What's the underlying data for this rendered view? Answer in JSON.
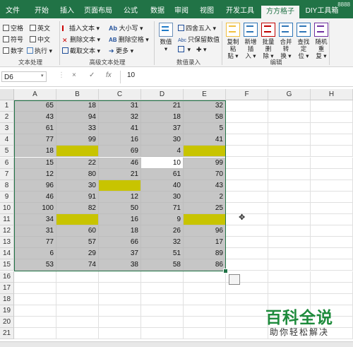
{
  "tabs": [
    "文件",
    "开始",
    "插入",
    "页面布局",
    "公式",
    "数据",
    "审阅",
    "视图",
    "开发工具",
    "方方格子",
    "DIY工具箱"
  ],
  "active_tab": "方方格子",
  "top_right_text": "8888",
  "ribbon": {
    "text_group": {
      "items": [
        "空格",
        "英文",
        "符号",
        "中文",
        "数字",
        "执行"
      ],
      "label": "文本处理"
    },
    "adv_group": {
      "items": [
        "插入文本",
        "大小写",
        "删除文本",
        "删除空格",
        "截取文本",
        "更多"
      ],
      "label": "高级文本处理"
    },
    "input_group": {
      "number_btn": "数值",
      "round": "四舍五入",
      "keep_value": "只保留数值",
      "label": "数值录入"
    },
    "edit_group": {
      "buttons": [
        {
          "l1": "复制粘",
          "l2": "贴"
        },
        {
          "l1": "新增插",
          "l2": "入"
        },
        {
          "l1": "批量删",
          "l2": "除"
        },
        {
          "l1": "合并转",
          "l2": "换"
        },
        {
          "l1": "查找定",
          "l2": "位"
        },
        {
          "l1": "随机重",
          "l2": "复"
        }
      ],
      "label": "编辑"
    }
  },
  "formula_bar": {
    "name_box": "D6",
    "cancel": "×",
    "confirm": "✓",
    "fx": "fx",
    "value": "10"
  },
  "columns": [
    "A",
    "B",
    "C",
    "D",
    "E",
    "F",
    "G",
    "H"
  ],
  "rows": [
    "1",
    "2",
    "3",
    "4",
    "5",
    "6",
    "7",
    "8",
    "9",
    "10",
    "11",
    "12",
    "13",
    "14",
    "15",
    "16",
    "17",
    "18",
    "19",
    "20",
    "21"
  ],
  "data": [
    [
      "65",
      "18",
      "31",
      "21",
      "32"
    ],
    [
      "43",
      "94",
      "32",
      "18",
      "58"
    ],
    [
      "61",
      "33",
      "41",
      "37",
      "5"
    ],
    [
      "77",
      "99",
      "16",
      "30",
      "41"
    ],
    [
      "18",
      "",
      "69",
      "4",
      ""
    ],
    [
      "15",
      "22",
      "46",
      "10",
      "99"
    ],
    [
      "12",
      "80",
      "21",
      "61",
      "70"
    ],
    [
      "96",
      "30",
      "",
      "40",
      "43"
    ],
    [
      "46",
      "91",
      "12",
      "30",
      "2"
    ],
    [
      "100",
      "82",
      "50",
      "71",
      "25"
    ],
    [
      "34",
      "",
      "16",
      "9",
      ""
    ],
    [
      "31",
      "60",
      "18",
      "26",
      "96"
    ],
    [
      "77",
      "57",
      "66",
      "32",
      "17"
    ],
    [
      "6",
      "29",
      "37",
      "51",
      "89"
    ],
    [
      "53",
      "74",
      "38",
      "58",
      "86"
    ]
  ],
  "colors": {
    "range_fill": "#c6c6c6",
    "blank_fill": "#c8c400",
    "active_fill": "#ffffff",
    "accent": "#217346"
  },
  "watermark": {
    "line1": "百科全说",
    "line2": "助你轻松解决"
  }
}
